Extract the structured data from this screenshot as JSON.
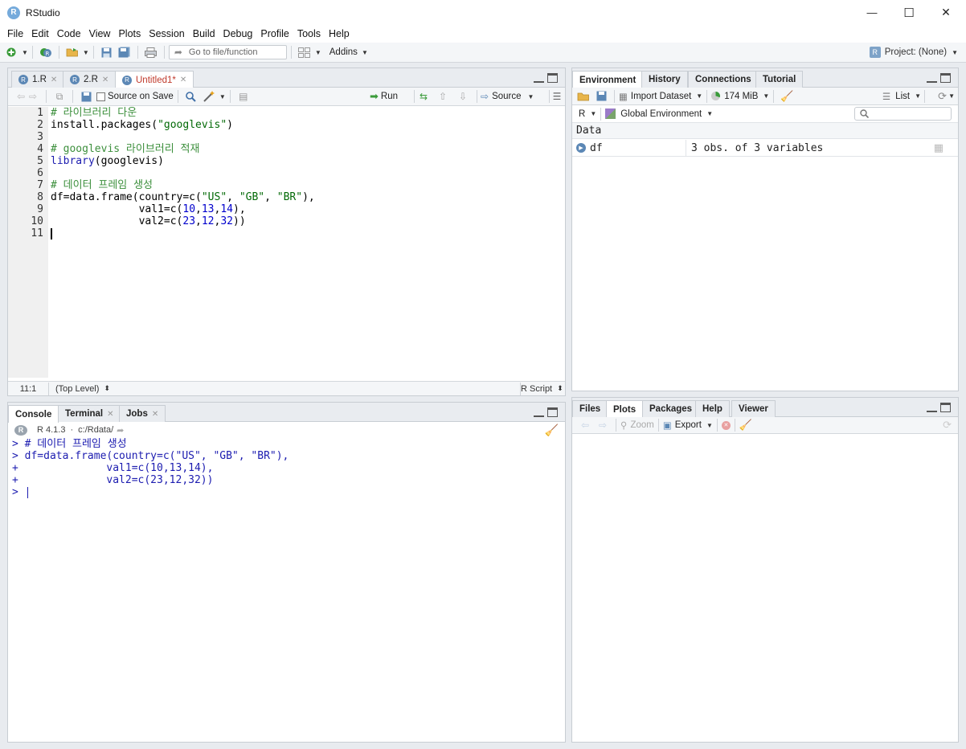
{
  "window": {
    "title": "RStudio",
    "app_icon_letter": "R",
    "controls": {
      "minimize": "—",
      "maximize": "☐",
      "close": "✕"
    }
  },
  "menu": [
    "File",
    "Edit",
    "Code",
    "View",
    "Plots",
    "Session",
    "Build",
    "Debug",
    "Profile",
    "Tools",
    "Help"
  ],
  "toolbar": {
    "goto_placeholder": "Go to file/function",
    "addins_label": "Addins",
    "project_label": "Project: (None)"
  },
  "editor": {
    "tabs": [
      {
        "label": "1.R",
        "active": false,
        "modified": false
      },
      {
        "label": "2.R",
        "active": false,
        "modified": false
      },
      {
        "label": "Untitled1*",
        "active": true,
        "modified": true
      }
    ],
    "source_on_save_label": "Source on Save",
    "run_label": "Run",
    "source_label": "Source",
    "line_numbers": [
      "1",
      "2",
      "3",
      "4",
      "5",
      "6",
      "7",
      "8",
      "9",
      "10",
      "11"
    ],
    "status": {
      "position": "11:1",
      "scope": "(Top Level)",
      "file_type": "R Script"
    }
  },
  "console": {
    "tabs": [
      {
        "label": "Console",
        "active": true
      },
      {
        "label": "Terminal",
        "active": false
      },
      {
        "label": "Jobs",
        "active": false
      }
    ],
    "r_version": "R 4.1.3",
    "working_dir": "c:/Rdata/",
    "lines": [
      "> # 데이터 프레임 생성",
      "> df=data.frame(country=c(\"US\", \"GB\", \"BR\"),",
      "+              val1=c(10,13,14),",
      "+              val2=c(23,12,32))",
      "> "
    ]
  },
  "environment": {
    "tabs": [
      {
        "label": "Environment",
        "active": true
      },
      {
        "label": "History",
        "active": false
      },
      {
        "label": "Connections",
        "active": false
      },
      {
        "label": "Tutorial",
        "active": false
      }
    ],
    "import_label": "Import Dataset",
    "memory_label": "174 MiB",
    "view_mode": "List",
    "language": "R",
    "scope": "Global Environment",
    "section_header": "Data",
    "rows": [
      {
        "name": "df",
        "value": "3 obs. of 3 variables"
      }
    ]
  },
  "files": {
    "tabs": [
      {
        "label": "Files",
        "active": false
      },
      {
        "label": "Plots",
        "active": true
      },
      {
        "label": "Packages",
        "active": false
      },
      {
        "label": "Help",
        "active": false
      },
      {
        "label": "Viewer",
        "active": false
      }
    ],
    "zoom_label": "Zoom",
    "export_label": "Export"
  }
}
